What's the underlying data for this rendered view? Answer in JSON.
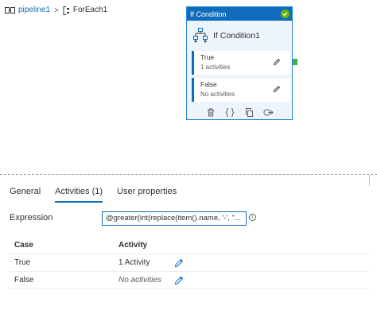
{
  "breadcrumb": {
    "pipeline": "pipeline1",
    "separator": ">",
    "foreach": "ForEach1"
  },
  "activity_card": {
    "header": "If Condition",
    "status": "success",
    "title": "If Condition1",
    "branches": [
      {
        "name": "True",
        "summary": "1 activities"
      },
      {
        "name": "False",
        "summary": "No activities"
      }
    ],
    "actions": [
      "delete-icon",
      "code-icon",
      "copy-icon",
      "add-output-icon"
    ]
  },
  "tabs": [
    {
      "label": "General",
      "active": false
    },
    {
      "label": "Activities (1)",
      "active": true
    },
    {
      "label": "User properties",
      "active": false
    }
  ],
  "expression": {
    "label": "Expression",
    "value": "@greater(int(replace(item().name, '-', ''..."
  },
  "table": {
    "headers": [
      "Case",
      "Activity"
    ],
    "rows": [
      {
        "case": "True",
        "activity": "1 Activity"
      },
      {
        "case": "False",
        "activity": "No activities"
      }
    ]
  },
  "colors": {
    "accent": "#0f6cbd",
    "success": "#6bb700",
    "connector": "#3bb44a"
  }
}
